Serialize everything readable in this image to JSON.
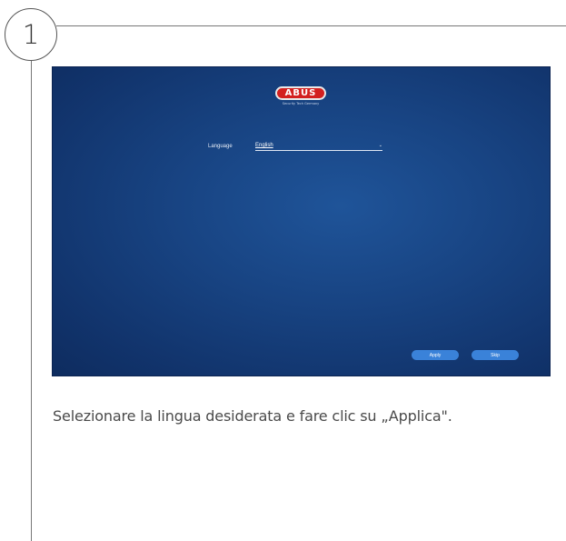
{
  "step": {
    "number": "1"
  },
  "screen": {
    "logo": {
      "text": "ABUS",
      "tagline": "Security Tech Germany"
    },
    "language": {
      "label": "Language",
      "value": "English"
    },
    "buttons": {
      "apply": "Apply",
      "skip": "Skip"
    }
  },
  "caption": "Selezionare la lingua desiderata e fare clic su „Applica\".",
  "colors": {
    "screen_bg": "#184483",
    "button": "#3a82d9",
    "logo_red": "#d3201f"
  }
}
